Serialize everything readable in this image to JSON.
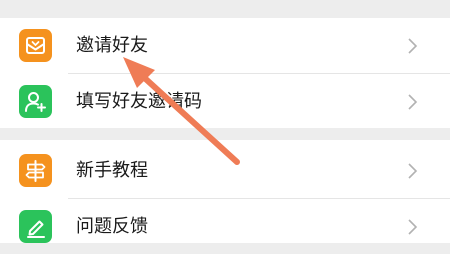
{
  "colors": {
    "background": "#ededed",
    "row_background": "#ffffff",
    "orange_icon": "#f5921e",
    "green_icon": "#2bc35b",
    "annotation_arrow": "#ef7c56",
    "chevron": "#b2b2b2"
  },
  "groups": [
    {
      "rows": [
        {
          "label": "邀请好友",
          "icon": "mail-envelope-icon",
          "icon_color": "orange"
        },
        {
          "label": "填写好友邀请码",
          "icon": "add-user-icon",
          "icon_color": "green"
        }
      ]
    },
    {
      "rows": [
        {
          "label": "新手教程",
          "icon": "signpost-icon",
          "icon_color": "orange"
        },
        {
          "label": "问题反馈",
          "icon": "edit-pencil-icon",
          "icon_color": "green"
        }
      ]
    }
  ],
  "annotation": {
    "type": "arrow",
    "points_to": "邀请好友"
  }
}
